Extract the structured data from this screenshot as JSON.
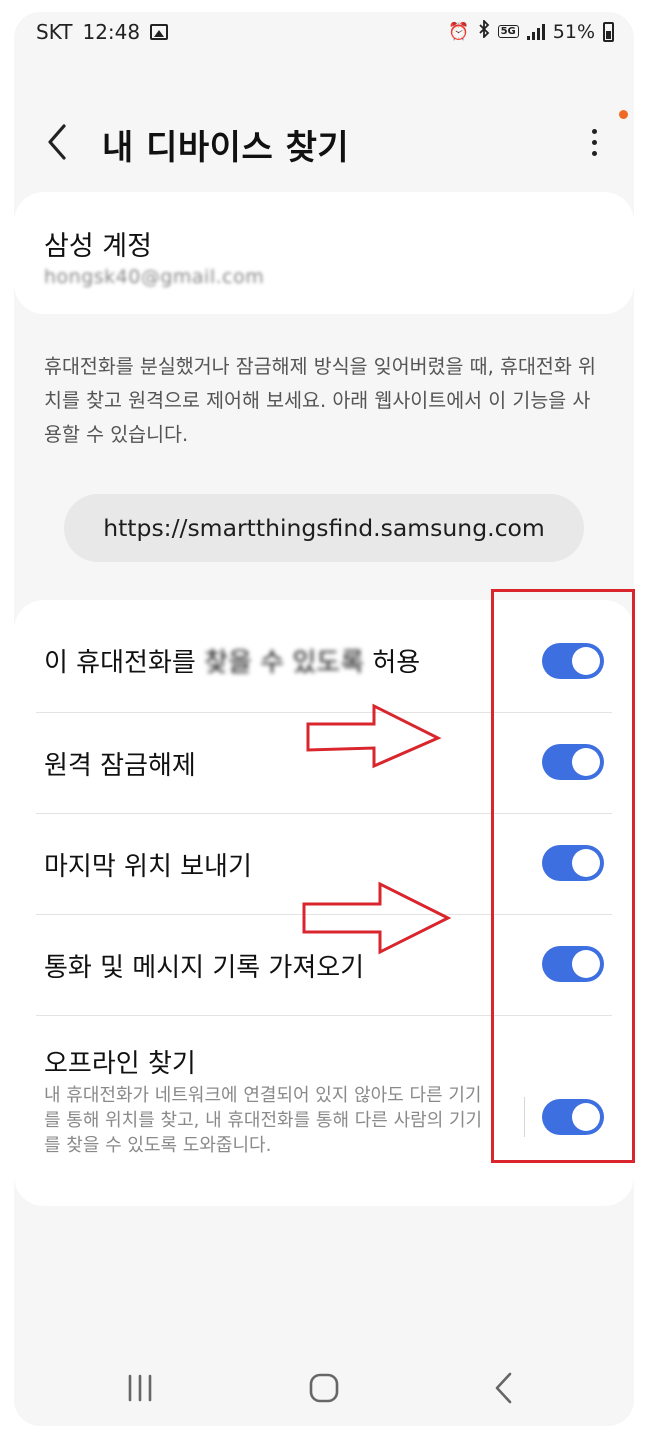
{
  "status_bar": {
    "carrier": "SKT",
    "time": "12:48",
    "network": "5G",
    "battery": "51%"
  },
  "header": {
    "title": "내 디바이스 찾기"
  },
  "account": {
    "title": "삼성 계정",
    "email": "hongsk40@gmail.com"
  },
  "description": "휴대전화를 분실했거나 잠금해제 방식을 잊어버렸을 때, 휴대전화 위치를 찾고 원격으로 제어해 보세요. 아래 웹사이트에서 이 기능을 사용할 수 있습니다.",
  "website": {
    "url": "https://smartthingsfind.samsung.com"
  },
  "settings": [
    {
      "label_a": "이 휴대전화를 ",
      "label_blur": "찾을 수 있도록",
      "label_b": " 허용",
      "enabled": true
    },
    {
      "label": "원격 잠금해제",
      "enabled": true
    },
    {
      "label": "마지막 위치 보내기",
      "enabled": true
    },
    {
      "label": "통화 및 메시지 기록 가져오기",
      "enabled": true
    },
    {
      "label": "오프라인 찾기",
      "sub": "내 휴대전화가 네트워크에 연결되어 있지 않아도 다른 기기를 통해 위치를 찾고, 내 휴대전화를 통해 다른 사람의 기기를 찾을 수 있도록 도와줍니다.",
      "enabled": true
    }
  ],
  "colors": {
    "toggle_on": "#3e6fe0",
    "annotation": "#d9252c",
    "notification_dot": "#f06a24"
  },
  "icons": [
    "image-icon",
    "alarm-icon",
    "bluetooth-icon",
    "signal-icon",
    "battery-icon",
    "back-arrow-icon",
    "more-options-icon",
    "recents-icon",
    "home-icon",
    "nav-back-icon"
  ]
}
